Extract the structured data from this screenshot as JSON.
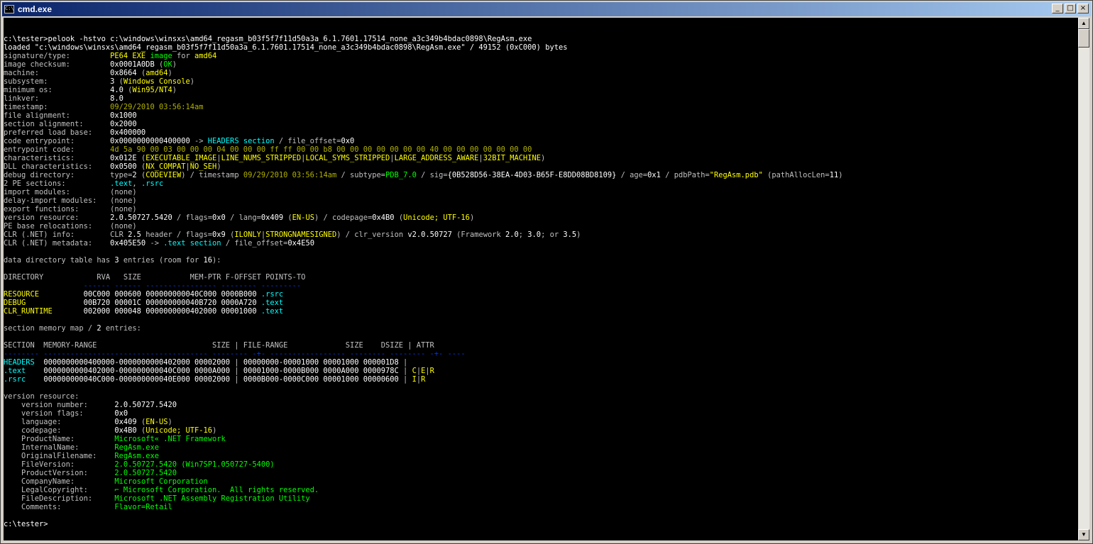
{
  "window": {
    "title": "cmd.exe",
    "icon": "cmd-icon",
    "minimize": "_",
    "maximize": "□",
    "close": "×"
  },
  "scroll": {
    "up": "▲",
    "down": "▼"
  },
  "lines": [
    [],
    [
      [
        "w",
        "c:\\tester>pelook -hstvo c:\\windows\\winsxs\\amd64_regasm_b03f5f7f11d50a3a_6.1.7601.17514_none_a3c349b4bdac0898\\RegAsm.exe"
      ]
    ],
    [
      [
        "w",
        "loaded \"c:\\windows\\winsxs\\amd64_regasm_b03f5f7f11d50a3a_6.1.7601.17514_none_a3c349b4bdac0898\\RegAsm.exe\" / 49152 (0xC000) bytes"
      ]
    ],
    [
      [
        "s",
        "signature/type:         "
      ],
      [
        "y",
        "PE64 EXE "
      ],
      [
        "g",
        "image "
      ],
      [
        "s",
        "for "
      ],
      [
        "y",
        "amd64"
      ]
    ],
    [
      [
        "s",
        "image checksum:         "
      ],
      [
        "w",
        "0x0001A0DB "
      ],
      [
        "s",
        "("
      ],
      [
        "g",
        "OK"
      ],
      [
        "s",
        ")"
      ]
    ],
    [
      [
        "s",
        "machine:                "
      ],
      [
        "w",
        "0x8664 "
      ],
      [
        "s",
        "("
      ],
      [
        "y",
        "amd64"
      ],
      [
        "s",
        ")"
      ]
    ],
    [
      [
        "s",
        "subsystem:              "
      ],
      [
        "w",
        "3 "
      ],
      [
        "s",
        "("
      ],
      [
        "y",
        "Windows Console"
      ],
      [
        "s",
        ")"
      ]
    ],
    [
      [
        "s",
        "minimum os:             "
      ],
      [
        "w",
        "4.0 "
      ],
      [
        "s",
        "("
      ],
      [
        "y",
        "Win95/NT4"
      ],
      [
        "s",
        ")"
      ]
    ],
    [
      [
        "s",
        "linkver:                "
      ],
      [
        "w",
        "8.0"
      ]
    ],
    [
      [
        "s",
        "timestamp:              "
      ],
      [
        "o",
        "09/29/2010 03:56:14am"
      ]
    ],
    [
      [
        "s",
        "file alignment:         "
      ],
      [
        "w",
        "0x1000"
      ]
    ],
    [
      [
        "s",
        "section alignment:      "
      ],
      [
        "w",
        "0x2000"
      ]
    ],
    [
      [
        "s",
        "preferred load base:    "
      ],
      [
        "w",
        "0x400000"
      ]
    ],
    [
      [
        "s",
        "code entrypoint:        "
      ],
      [
        "w",
        "0x0000000000400000 "
      ],
      [
        "s",
        "-> "
      ],
      [
        "c",
        "HEADERS section "
      ],
      [
        "s",
        "/ file_offset="
      ],
      [
        "w",
        "0x0"
      ]
    ],
    [
      [
        "s",
        "entrypoint code:        "
      ],
      [
        "o",
        "4d 5a 90 00 03 00 00 00 04 00 00 00 ff ff 00 00 b8 00 00 00 00 00 00 00 40 00 00 00 00 00 00 00"
      ]
    ],
    [
      [
        "s",
        "characteristics:        "
      ],
      [
        "w",
        "0x012E "
      ],
      [
        "s",
        "("
      ],
      [
        "y",
        "EXECUTABLE_IMAGE"
      ],
      [
        "s",
        "|"
      ],
      [
        "y",
        "LINE_NUMS_STRIPPED"
      ],
      [
        "s",
        "|"
      ],
      [
        "y",
        "LOCAL_SYMS_STRIPPED"
      ],
      [
        "s",
        "|"
      ],
      [
        "y",
        "LARGE_ADDRESS_AWARE"
      ],
      [
        "s",
        "|"
      ],
      [
        "y",
        "32BIT_MACHINE"
      ],
      [
        "s",
        ")"
      ]
    ],
    [
      [
        "s",
        "DLL characteristics:    "
      ],
      [
        "w",
        "0x0500 "
      ],
      [
        "s",
        "("
      ],
      [
        "y",
        "NX_COMPAT"
      ],
      [
        "s",
        "|"
      ],
      [
        "y",
        "NO_SEH"
      ],
      [
        "s",
        ")"
      ]
    ],
    [
      [
        "s",
        "debug directory:        "
      ],
      [
        "s",
        "type="
      ],
      [
        "w",
        "2 "
      ],
      [
        "s",
        "("
      ],
      [
        "y",
        "CODEVIEW"
      ],
      [
        "s",
        ") / timestamp "
      ],
      [
        "o",
        "09/29/2010 03:56:14am "
      ],
      [
        "s",
        "/ subtype="
      ],
      [
        "g",
        "PDB_7.0 "
      ],
      [
        "s",
        "/ sig="
      ],
      [
        "w",
        "{0B528D56-38EA-4D03-B65F-E8DD08BD8109} "
      ],
      [
        "s",
        "/ age="
      ],
      [
        "w",
        "0x1 "
      ],
      [
        "s",
        "/ pdbPath="
      ],
      [
        "y",
        "\"RegAsm.pdb\" "
      ],
      [
        "s",
        "(pathAllocLen="
      ],
      [
        "w",
        "11"
      ],
      [
        "s",
        ")"
      ]
    ],
    [
      [
        "s",
        "2 PE sections:          "
      ],
      [
        "c",
        ".text"
      ],
      [
        "s",
        ", "
      ],
      [
        "c",
        ".rsrc"
      ]
    ],
    [
      [
        "s",
        "import modules:         "
      ],
      [
        "s",
        "(none)"
      ]
    ],
    [
      [
        "s",
        "delay-import modules:   "
      ],
      [
        "s",
        "(none)"
      ]
    ],
    [
      [
        "s",
        "export functions:       "
      ],
      [
        "s",
        "(none)"
      ]
    ],
    [
      [
        "s",
        "version resource:       "
      ],
      [
        "w",
        "2.0.50727.5420 "
      ],
      [
        "s",
        "/ flags="
      ],
      [
        "w",
        "0x0 "
      ],
      [
        "s",
        "/ lang="
      ],
      [
        "w",
        "0x409 "
      ],
      [
        "s",
        "("
      ],
      [
        "y",
        "EN-US"
      ],
      [
        "s",
        ") / codepage="
      ],
      [
        "w",
        "0x4B0 "
      ],
      [
        "s",
        "("
      ],
      [
        "y",
        "Unicode; UTF-16"
      ],
      [
        "s",
        ")"
      ]
    ],
    [
      [
        "s",
        "PE base relocations:    "
      ],
      [
        "s",
        "(none)"
      ]
    ],
    [
      [
        "s",
        "CLR (.NET) info:        "
      ],
      [
        "s",
        "CLR "
      ],
      [
        "w",
        "2.5 "
      ],
      [
        "s",
        "header / flags="
      ],
      [
        "w",
        "0x9 "
      ],
      [
        "s",
        "("
      ],
      [
        "y",
        "ILONLY"
      ],
      [
        "s",
        "|"
      ],
      [
        "y",
        "STRONGNAMESIGNED"
      ],
      [
        "s",
        ") / clr_version "
      ],
      [
        "w",
        "v2.0.50727 "
      ],
      [
        "s",
        "(Framework "
      ],
      [
        "w",
        "2.0"
      ],
      [
        "s",
        "; "
      ],
      [
        "w",
        "3.0"
      ],
      [
        "s",
        "; or "
      ],
      [
        "w",
        "3.5"
      ],
      [
        "s",
        ")"
      ]
    ],
    [
      [
        "s",
        "CLR (.NET) metadata:    "
      ],
      [
        "w",
        "0x405E50 "
      ],
      [
        "s",
        "-> "
      ],
      [
        "c",
        ".text section "
      ],
      [
        "s",
        "/ file_offset="
      ],
      [
        "w",
        "0x4E50"
      ]
    ],
    [],
    [
      [
        "s",
        "data directory table has "
      ],
      [
        "w",
        "3 "
      ],
      [
        "s",
        "entries (room for "
      ],
      [
        "w",
        "16"
      ],
      [
        "s",
        "):"
      ]
    ],
    [],
    [
      [
        "s",
        "DIRECTORY            RVA   SIZE           MEM-PTR F-OFFSET POINTS-TO"
      ]
    ],
    [
      [
        "b",
        "                  ------ ------ ---------------- -------- ---------"
      ]
    ],
    [
      [
        "y",
        "RESOURCE          "
      ],
      [
        "w",
        "00C000 000600 000000000040C000 0000B000 "
      ],
      [
        "c",
        ".rsrc"
      ]
    ],
    [
      [
        "y",
        "DEBUG             "
      ],
      [
        "w",
        "00B720 00001C 000000000040B720 0000A720 "
      ],
      [
        "c",
        ".text"
      ]
    ],
    [
      [
        "y",
        "CLR_RUNTIME       "
      ],
      [
        "w",
        "002000 000048 0000000000402000 00001000 "
      ],
      [
        "c",
        ".text"
      ]
    ],
    [],
    [
      [
        "s",
        "section memory map / "
      ],
      [
        "w",
        "2 "
      ],
      [
        "s",
        "entries:"
      ]
    ],
    [],
    [
      [
        "s",
        "SECTION  MEMORY-RANGE                          SIZE "
      ],
      [
        "s",
        "| FILE-RANGE             SIZE    DSIZE "
      ],
      [
        "s",
        "| ATTR"
      ]
    ],
    [
      [
        "b",
        "-------- ------------------------------------- -------- -+- ----------------- -------- -------- -+- ----"
      ]
    ],
    [
      [
        "c",
        "HEADERS  "
      ],
      [
        "w",
        "0000000000400000-0000000000402000 00002000 "
      ],
      [
        "s",
        "| "
      ],
      [
        "w",
        "00000000-00001000 00001000 000001D8 "
      ],
      [
        "s",
        "|"
      ]
    ],
    [
      [
        "c",
        ".text    "
      ],
      [
        "w",
        "0000000000402000-000000000040C000 0000A000 "
      ],
      [
        "s",
        "| "
      ],
      [
        "w",
        "00001000-0000B000 0000A000 0000978C "
      ],
      [
        "s",
        "| "
      ],
      [
        "y",
        "C"
      ],
      [
        "s",
        "|"
      ],
      [
        "y",
        "E"
      ],
      [
        "s",
        "|"
      ],
      [
        "y",
        "R"
      ]
    ],
    [
      [
        "c",
        ".rsrc    "
      ],
      [
        "w",
        "000000000040C000-000000000040E000 00002000 "
      ],
      [
        "s",
        "| "
      ],
      [
        "w",
        "0000B000-0000C000 00001000 00000600 "
      ],
      [
        "s",
        "| "
      ],
      [
        "y",
        "I"
      ],
      [
        "s",
        "|"
      ],
      [
        "y",
        "R"
      ]
    ],
    [],
    [
      [
        "s",
        "version resource:"
      ]
    ],
    [
      [
        "s",
        "    version number:      "
      ],
      [
        "w",
        "2.0.50727.5420"
      ]
    ],
    [
      [
        "s",
        "    version flags:       "
      ],
      [
        "w",
        "0x0"
      ]
    ],
    [
      [
        "s",
        "    language:            "
      ],
      [
        "w",
        "0x409 "
      ],
      [
        "s",
        "("
      ],
      [
        "y",
        "EN-US"
      ],
      [
        "s",
        ")"
      ]
    ],
    [
      [
        "s",
        "    codepage:            "
      ],
      [
        "w",
        "0x4B0 "
      ],
      [
        "s",
        "("
      ],
      [
        "y",
        "Unicode; UTF-16"
      ],
      [
        "s",
        ")"
      ]
    ],
    [
      [
        "s",
        "    ProductName:         "
      ],
      [
        "g",
        "Microsoft« .NET Framework"
      ]
    ],
    [
      [
        "s",
        "    InternalName:        "
      ],
      [
        "g",
        "RegAsm.exe"
      ]
    ],
    [
      [
        "s",
        "    OriginalFilename:    "
      ],
      [
        "g",
        "RegAsm.exe"
      ]
    ],
    [
      [
        "s",
        "    FileVersion:         "
      ],
      [
        "g",
        "2.0.50727.5420 (Win7SP1.050727-5400)"
      ]
    ],
    [
      [
        "s",
        "    ProductVersion:      "
      ],
      [
        "g",
        "2.0.50727.5420"
      ]
    ],
    [
      [
        "s",
        "    CompanyName:         "
      ],
      [
        "g",
        "Microsoft Corporation"
      ]
    ],
    [
      [
        "s",
        "    LegalCopyright:      "
      ],
      [
        "g",
        "⌐ Microsoft Corporation.  All rights reserved."
      ]
    ],
    [
      [
        "s",
        "    FileDescription:     "
      ],
      [
        "g",
        "Microsoft .NET Assembly Registration Utility"
      ]
    ],
    [
      [
        "s",
        "    Comments:            "
      ],
      [
        "g",
        "Flavor=Retail"
      ]
    ],
    [],
    [
      [
        "w",
        "c:\\tester>"
      ]
    ]
  ]
}
